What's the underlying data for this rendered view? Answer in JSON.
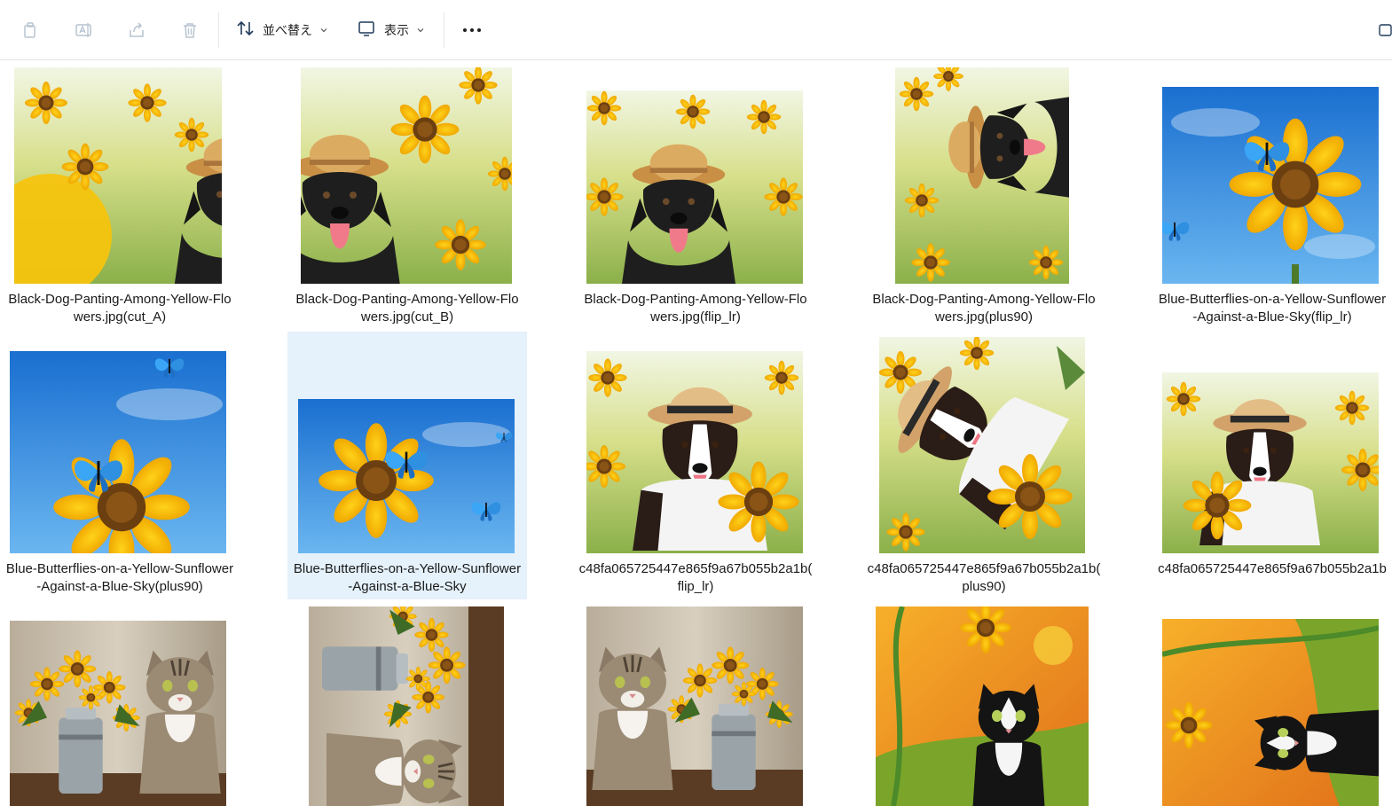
{
  "toolbar": {
    "icons": [
      "copy-icon",
      "rename-icon",
      "share-icon",
      "delete-icon"
    ],
    "sort_label": "並べ替え",
    "view_label": "表示",
    "more_label": "•••"
  },
  "files": [
    {
      "line1": "Black-Dog-Panting-Among-Yellow-Flo",
      "line2": "wers.jpg(cut_A)",
      "selected": false
    },
    {
      "line1": "Black-Dog-Panting-Among-Yellow-Flo",
      "line2": "wers.jpg(cut_B)",
      "selected": false
    },
    {
      "line1": "Black-Dog-Panting-Among-Yellow-Flo",
      "line2": "wers.jpg(flip_lr)",
      "selected": false
    },
    {
      "line1": "Black-Dog-Panting-Among-Yellow-Flo",
      "line2": "wers.jpg(plus90)",
      "selected": false
    },
    {
      "line1": "Blue-Butterflies-on-a-Yellow-Sunflower",
      "line2": "-Against-a-Blue-Sky(flip_lr)",
      "selected": false
    },
    {
      "line1": "Blue-Butterflies-on-a-Yellow-Sunflower",
      "line2": "-Against-a-Blue-Sky(plus90)",
      "selected": false
    },
    {
      "line1": "Blue-Butterflies-on-a-Yellow-Sunflower",
      "line2": "-Against-a-Blue-Sky",
      "selected": true
    },
    {
      "line1": "c48fa065725447e865f9a67b055b2a1b(",
      "line2": "flip_lr)",
      "selected": false
    },
    {
      "line1": "c48fa065725447e865f9a67b055b2a1b(",
      "line2": "plus90)",
      "selected": false
    },
    {
      "line1": "c48fa065725447e865f9a67b055b2a1b",
      "line2": "",
      "selected": false
    },
    {
      "line1": "",
      "line2": "",
      "selected": false
    },
    {
      "line1": "",
      "line2": "",
      "selected": false
    },
    {
      "line1": "",
      "line2": "",
      "selected": false
    },
    {
      "line1": "",
      "line2": "",
      "selected": false
    },
    {
      "line1": "",
      "line2": "",
      "selected": false
    }
  ],
  "colors": {
    "selection": "#e5f1fb",
    "sky": "#2a7fd4",
    "sunflower": "#f5c518",
    "sunflower_center": "#7a4a12",
    "dog_black": "#1c1c1c",
    "straw_hat": "#d9a55a",
    "butterfly": "#3aa0f0",
    "cat_orange_bg": "#e88a1a"
  }
}
